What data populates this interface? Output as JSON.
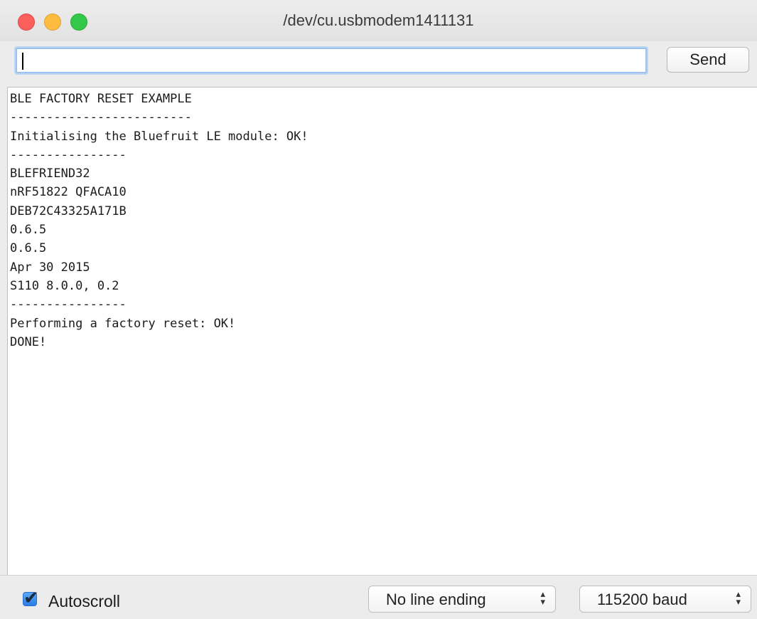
{
  "window": {
    "title": "/dev/cu.usbmodem1411131"
  },
  "input": {
    "value": "",
    "send_label": "Send"
  },
  "output": {
    "lines": [
      "BLE FACTORY RESET EXAMPLE",
      "-------------------------",
      "Initialising the Bluefruit LE module: OK!",
      "----------------",
      "BLEFRIEND32",
      "nRF51822 QFACA10",
      "DEB72C43325A171B",
      "0.6.5",
      "0.6.5",
      "Apr 30 2015",
      "S110 8.0.0, 0.2",
      "----------------",
      "Performing a factory reset: OK!",
      "DONE!"
    ]
  },
  "footer": {
    "autoscroll_label": "Autoscroll",
    "autoscroll_checked": true,
    "line_ending": "No line ending",
    "baud": "115200 baud"
  }
}
